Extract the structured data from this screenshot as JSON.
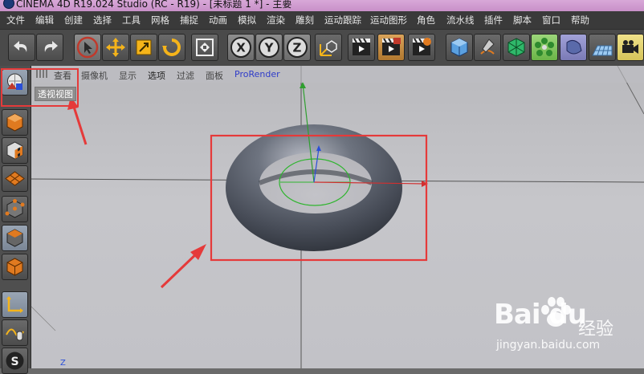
{
  "window": {
    "title": "CINEMA 4D R19.024 Studio (RC - R19) - [未标题 1 *] - 主要"
  },
  "menu": [
    "文件",
    "编辑",
    "创建",
    "选择",
    "工具",
    "网格",
    "捕捉",
    "动画",
    "模拟",
    "渲染",
    "雕刻",
    "运动跟踪",
    "运动图形",
    "角色",
    "流水线",
    "插件",
    "脚本",
    "窗口",
    "帮助"
  ],
  "toolbar": {
    "icons": [
      "undo-icon",
      "redo-icon",
      "select-arrow-icon",
      "move-icon",
      "scale-icon",
      "rotate-icon",
      "recent-tools-icon",
      "x-axis-icon",
      "y-axis-icon",
      "z-axis-icon",
      "coordinate-system-icon",
      "render-view-icon",
      "render-picture-viewer-icon",
      "render-settings-icon",
      "cube-icon",
      "pen-icon",
      "subdivision-icon",
      "array-icon",
      "deformer-icon",
      "floor-icon",
      "camera-icon"
    ]
  },
  "viewport_menu": {
    "items": [
      "查看",
      "摄像机",
      "显示",
      "选项",
      "过滤",
      "面板",
      "ProRender"
    ],
    "active_item": "选项",
    "view_name": "透视视图",
    "axis_label": "Z"
  },
  "sidebar": {
    "icons": [
      "make-editable-icon",
      "model-mode-icon",
      "texture-mode-icon",
      "workplane-icon",
      "points-mode-icon",
      "edges-mode-icon",
      "polygons-mode-icon",
      "axis-mode-icon",
      "tweak-icon",
      "solo-icon"
    ]
  },
  "watermark": {
    "brand": "Bai du",
    "cn": "经验",
    "url": "jingyan.baidu.com"
  },
  "colors": {
    "highlight": "#e53a3a",
    "selection": "#2fb52f",
    "axis_x": "#d03030",
    "axis_y": "#2f9f2f",
    "axis_z": "#2a4fd8",
    "torus": "#4f5563"
  }
}
